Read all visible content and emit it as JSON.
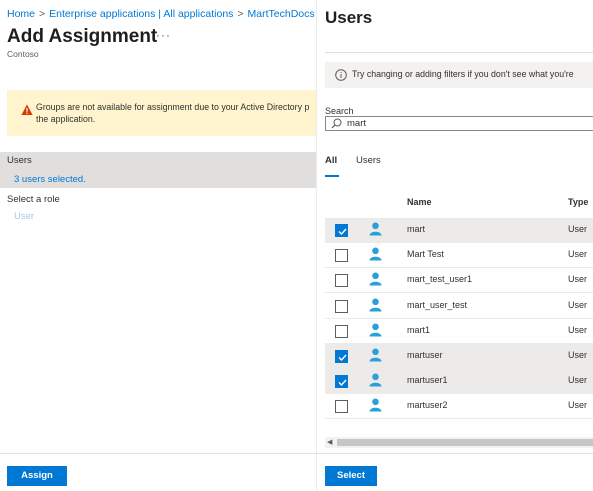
{
  "breadcrumb": [
    "Home",
    "Enterprise applications | All applications",
    "MartTechDocs"
  ],
  "left": {
    "title": "Add Assignment",
    "more": "···",
    "tenant": "Contoso",
    "warning": "Groups are not available for assignment due to your Active Directory p the application.",
    "users_label": "Users",
    "users_selected": "3 users selected.",
    "role_label": "Select a role",
    "role_value": "User",
    "assign_button": "Assign"
  },
  "right": {
    "title": "Users",
    "info": "Try changing or adding filters if you don't see what you're",
    "search_label": "Search",
    "search_value": "mart",
    "tabs": [
      "All",
      "Users"
    ],
    "col_name": "Name",
    "col_type": "Type",
    "rows": [
      {
        "name": "mart",
        "type": "User",
        "selected": true
      },
      {
        "name": "Mart Test",
        "type": "User",
        "selected": false
      },
      {
        "name": "mart_test_user1",
        "type": "User",
        "selected": false
      },
      {
        "name": "mart_user_test",
        "type": "User",
        "selected": false
      },
      {
        "name": "mart1",
        "type": "User",
        "selected": false
      },
      {
        "name": "martuser",
        "type": "User",
        "selected": true
      },
      {
        "name": "martuser1",
        "type": "User",
        "selected": true
      },
      {
        "name": "martuser2",
        "type": "User",
        "selected": false
      }
    ],
    "select_button": "Select"
  },
  "colors": {
    "accent": "#0078d4",
    "warning_bg": "#fff4ce",
    "warning_icon": "#d83b01",
    "user_icon": "#2aa0d8",
    "selected_row": "#edebe9"
  },
  "icons": [
    "warning-icon",
    "info-icon",
    "search-icon",
    "user-icon",
    "checkmark-icon",
    "more-icon"
  ]
}
